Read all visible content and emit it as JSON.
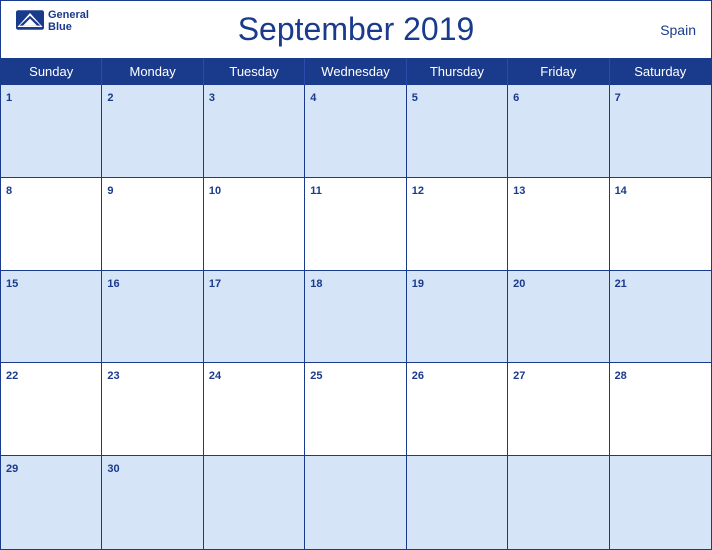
{
  "header": {
    "title": "September 2019",
    "country": "Spain",
    "logo_line1": "General",
    "logo_line2": "Blue"
  },
  "days_of_week": [
    "Sunday",
    "Monday",
    "Tuesday",
    "Wednesday",
    "Thursday",
    "Friday",
    "Saturday"
  ],
  "weeks": [
    [
      {
        "num": "1",
        "empty": false
      },
      {
        "num": "2",
        "empty": false
      },
      {
        "num": "3",
        "empty": false
      },
      {
        "num": "4",
        "empty": false
      },
      {
        "num": "5",
        "empty": false
      },
      {
        "num": "6",
        "empty": false
      },
      {
        "num": "7",
        "empty": false
      }
    ],
    [
      {
        "num": "8",
        "empty": false
      },
      {
        "num": "9",
        "empty": false
      },
      {
        "num": "10",
        "empty": false
      },
      {
        "num": "11",
        "empty": false
      },
      {
        "num": "12",
        "empty": false
      },
      {
        "num": "13",
        "empty": false
      },
      {
        "num": "14",
        "empty": false
      }
    ],
    [
      {
        "num": "15",
        "empty": false
      },
      {
        "num": "16",
        "empty": false
      },
      {
        "num": "17",
        "empty": false
      },
      {
        "num": "18",
        "empty": false
      },
      {
        "num": "19",
        "empty": false
      },
      {
        "num": "20",
        "empty": false
      },
      {
        "num": "21",
        "empty": false
      }
    ],
    [
      {
        "num": "22",
        "empty": false
      },
      {
        "num": "23",
        "empty": false
      },
      {
        "num": "24",
        "empty": false
      },
      {
        "num": "25",
        "empty": false
      },
      {
        "num": "26",
        "empty": false
      },
      {
        "num": "27",
        "empty": false
      },
      {
        "num": "28",
        "empty": false
      }
    ],
    [
      {
        "num": "29",
        "empty": false
      },
      {
        "num": "30",
        "empty": false
      },
      {
        "num": "",
        "empty": true
      },
      {
        "num": "",
        "empty": true
      },
      {
        "num": "",
        "empty": true
      },
      {
        "num": "",
        "empty": true
      },
      {
        "num": "",
        "empty": true
      }
    ]
  ],
  "colors": {
    "blue_dark": "#1a3a8c",
    "blue_row": "#d6e4f7",
    "white": "#ffffff"
  }
}
